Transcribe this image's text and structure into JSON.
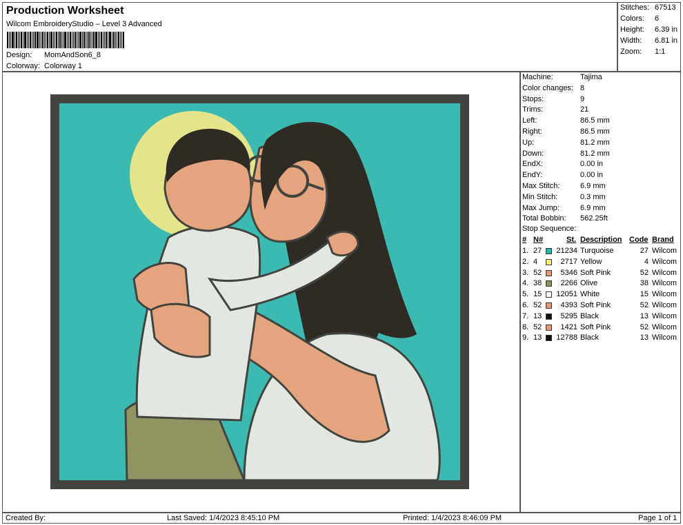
{
  "header": {
    "title": "Production Worksheet",
    "subtitle": "Wilcom EmbroideryStudio – Level 3 Advanced",
    "design_label": "Design:",
    "design_value": "MomAndSon6_8",
    "colorway_label": "Colorway:",
    "colorway_value": "Colorway 1"
  },
  "summary": [
    {
      "label": "Stitches:",
      "value": "67513"
    },
    {
      "label": "Colors:",
      "value": "6"
    },
    {
      "label": "Height:",
      "value": "6.39 in"
    },
    {
      "label": "Width:",
      "value": "6.81 in"
    },
    {
      "label": "Zoom:",
      "value": "1:1"
    }
  ],
  "details": [
    {
      "label": "Machine:",
      "value": "Tajima"
    },
    {
      "label": "Color changes:",
      "value": "8"
    },
    {
      "label": "Stops:",
      "value": "9"
    },
    {
      "label": "Trims:",
      "value": "21"
    },
    {
      "label": "Left:",
      "value": "86.5 mm"
    },
    {
      "label": "Right:",
      "value": "86.5 mm"
    },
    {
      "label": "Up:",
      "value": "81.2 mm"
    },
    {
      "label": "Down:",
      "value": "81.2 mm"
    },
    {
      "label": "EndX:",
      "value": "0.00 in"
    },
    {
      "label": "EndY:",
      "value": "0.00 in"
    },
    {
      "label": "Max Stitch:",
      "value": "6.9 mm"
    },
    {
      "label": "Min Stitch:",
      "value": "0.3 mm"
    },
    {
      "label": "Max Jump:",
      "value": "6.9 mm"
    },
    {
      "label": "Total Bobbin:",
      "value": "562.25ft"
    }
  ],
  "stop_sequence": {
    "title": "Stop Sequence:",
    "headers": {
      "num": "#",
      "n": "N#",
      "st": "St.",
      "description": "Description",
      "code": "Code",
      "brand": "Brand"
    },
    "rows": [
      {
        "num": "1.",
        "n": "27",
        "color": "#2bb3ad",
        "st": "21234",
        "description": "Turquoise",
        "code": "27",
        "brand": "Wilcom"
      },
      {
        "num": "2.",
        "n": "4",
        "color": "#f3f07a",
        "st": "2717",
        "description": "Yellow",
        "code": "4",
        "brand": "Wilcom"
      },
      {
        "num": "3.",
        "n": "52",
        "color": "#e8987a",
        "st": "5346",
        "description": "Soft Pink",
        "code": "52",
        "brand": "Wilcom"
      },
      {
        "num": "4.",
        "n": "38",
        "color": "#8f8f5e",
        "st": "2266",
        "description": "Olive",
        "code": "38",
        "brand": "Wilcom"
      },
      {
        "num": "5.",
        "n": "15",
        "color": "#ffffff",
        "st": "12051",
        "description": "White",
        "code": "15",
        "brand": "Wilcom"
      },
      {
        "num": "6.",
        "n": "52",
        "color": "#e8987a",
        "st": "4393",
        "description": "Soft Pink",
        "code": "52",
        "brand": "Wilcom"
      },
      {
        "num": "7.",
        "n": "13",
        "color": "#111111",
        "st": "5295",
        "description": "Black",
        "code": "13",
        "brand": "Wilcom"
      },
      {
        "num": "8.",
        "n": "52",
        "color": "#e8987a",
        "st": "1421",
        "description": "Soft Pink",
        "code": "52",
        "brand": "Wilcom"
      },
      {
        "num": "9.",
        "n": "13",
        "color": "#111111",
        "st": "12788",
        "description": "Black",
        "code": "13",
        "brand": "Wilcom"
      }
    ]
  },
  "footer": {
    "created_by": "Created By:",
    "last_saved": "Last Saved: 1/4/2023 8:45:10 PM",
    "printed": "Printed: 1/4/2023 8:46:09 PM",
    "page": "Page 1 of 1"
  },
  "colors": {
    "turquoise": "#3cb9b0",
    "yellow": "#e4e58a",
    "skin": "#e4a47e",
    "olive": "#8f9462",
    "white": "#e2e8df",
    "hair": "#2f2a24",
    "frame": "#43443f"
  }
}
